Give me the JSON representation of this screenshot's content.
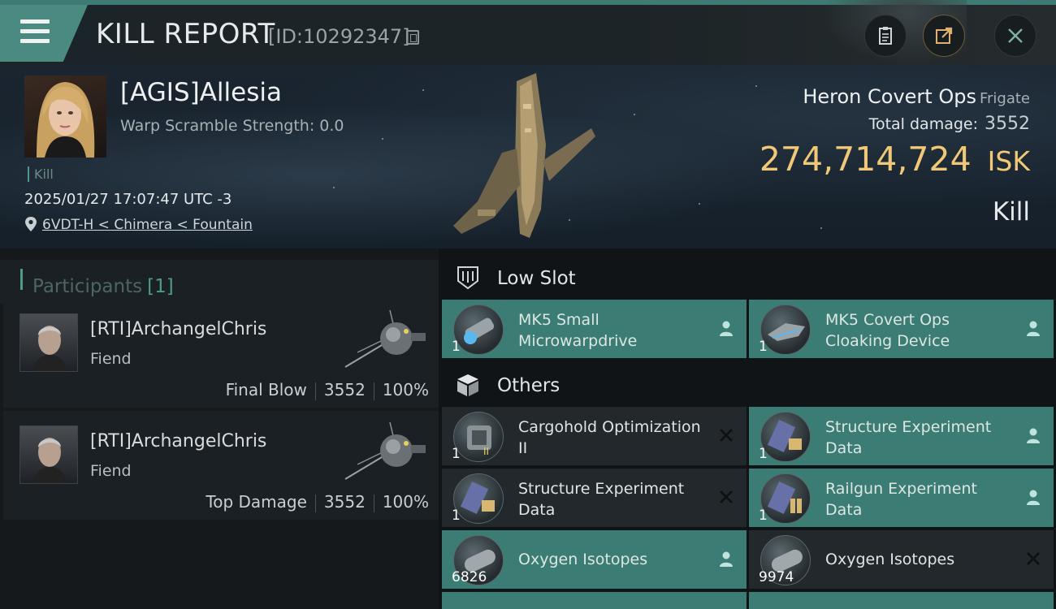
{
  "header": {
    "title": "KILL REPORT",
    "report_id": "[ID:10292347]"
  },
  "victim": {
    "name": "[AGIS]Allesia",
    "warp_scramble": "Warp Scramble Strength: 0.0",
    "tag": "Kill",
    "datetime": "2025/01/27 17:07:47 UTC -3",
    "location": "6VDT-H < Chimera < Fountain",
    "ship_name": "Heron Covert Ops",
    "ship_class": "Frigate",
    "total_damage_label": "Total damage:",
    "total_damage_value": "3552",
    "isk_value": "274,714,724",
    "isk_unit": "ISK",
    "result": "Kill"
  },
  "participants": {
    "title": "Participants",
    "count": "[1]",
    "list": [
      {
        "name": "[RTI]ArchangelChris",
        "ship": "Fiend",
        "role": "Final Blow",
        "damage": "3552",
        "percent": "100%"
      },
      {
        "name": "[RTI]ArchangelChris",
        "ship": "Fiend",
        "role": "Top Damage",
        "damage": "3552",
        "percent": "100%"
      }
    ]
  },
  "fitting": {
    "low_slot": {
      "title": "Low Slot",
      "items": [
        {
          "name": "MK5 Small Microwarpdrive",
          "qty": "1",
          "status": "dropped"
        },
        {
          "name": "MK5 Covert Ops Cloaking Device",
          "qty": "1",
          "status": "dropped"
        }
      ]
    },
    "others": {
      "title": "Others",
      "items": [
        {
          "name": "Cargohold Optimization II",
          "qty": "1",
          "status": "destroyed"
        },
        {
          "name": "Structure Experiment Data",
          "qty": "1",
          "status": "dropped"
        },
        {
          "name": "Structure Experiment Data",
          "qty": "1",
          "status": "destroyed"
        },
        {
          "name": "Railgun Experiment Data",
          "qty": "1",
          "status": "dropped"
        },
        {
          "name": "Oxygen Isotopes",
          "qty": "6826",
          "status": "dropped"
        },
        {
          "name": "Oxygen Isotopes",
          "qty": "9974",
          "status": "destroyed"
        }
      ]
    }
  },
  "colors": {
    "accent_teal": "#3b7d74",
    "isk_gold": "#f0c878"
  },
  "icons": [
    "menu-icon",
    "copy-icon",
    "clipboard-icon",
    "share-icon",
    "close-icon",
    "location-pin-icon",
    "low-slot-icon",
    "cube-icon",
    "person-icon",
    "x-mark-icon"
  ]
}
